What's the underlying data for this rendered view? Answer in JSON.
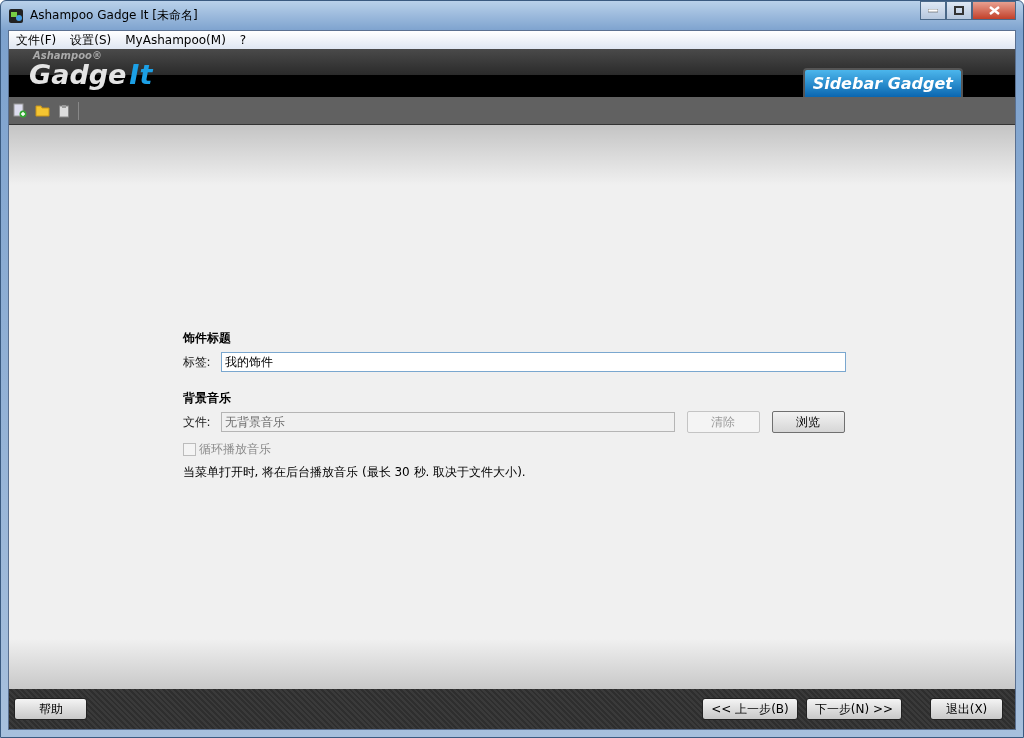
{
  "window": {
    "title": "Ashampoo Gadge It [未命名]"
  },
  "menu": [
    "文件(F)",
    "设置(S)",
    "MyAshampoo(M)",
    "?"
  ],
  "header": {
    "brand": "Ashampoo®",
    "product_name": "Gadge",
    "product_suffix": "It",
    "tab": "Sidebar Gadget"
  },
  "gadget_title": {
    "heading": "饰件标题",
    "label": "标签:",
    "value": "我的饰件",
    "focused": true
  },
  "music": {
    "heading": "背景音乐",
    "label": "文件:",
    "value": "无背景音乐",
    "disabled": true,
    "clear_button": {
      "label": "清除",
      "disabled": true
    },
    "browse_button": {
      "label": "浏览",
      "disabled": false
    },
    "loop": {
      "label": "循环播放音乐",
      "checked": false,
      "disabled": true
    },
    "note": "当菜单打开时, 将在后台播放音乐 (最长 30 秒. 取决于文件大小)."
  },
  "footer": {
    "help": "帮助",
    "back": "<< 上一步(B)",
    "next": "下一步(N) >>",
    "exit": "退出(X)"
  }
}
